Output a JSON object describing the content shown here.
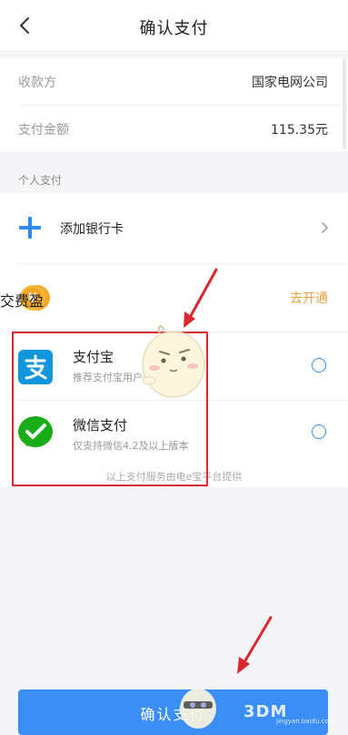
{
  "header": {
    "title": "确认支付",
    "back_icon": "chevron-left-icon"
  },
  "payment_info": {
    "payee_label": "收款方",
    "payee_value": "国家电网公司",
    "amount_label": "支付金额",
    "amount_value": "115.35元"
  },
  "section_label": "个人支付",
  "methods": {
    "add_card": {
      "label": "添加银行卡",
      "icon": "plus-icon"
    },
    "jiaofeiying": {
      "label": "交费盈",
      "action": "去开通",
      "icon": "yen-coin-icon"
    },
    "alipay": {
      "label": "支付宝",
      "sub": "推荐支付宝用户使用",
      "icon": "alipay-icon"
    },
    "wechat": {
      "label": "微信支付",
      "sub": "仅支持微信4.2及以上版本",
      "icon": "wechat-pay-icon"
    }
  },
  "footnote": "以上支付服务由电e宝平台提供",
  "confirm_label": "确认支付",
  "watermark": {
    "brand": "3DM",
    "sub": "jingyan.baidu.com"
  },
  "colors": {
    "accent": "#3a8ef6",
    "radio": "#2d8cf0",
    "open_link": "#f0a040",
    "alipay": "#1296db",
    "wechat": "#1aad19",
    "coin": "#f5a623",
    "annotation_red": "#d9282f"
  }
}
